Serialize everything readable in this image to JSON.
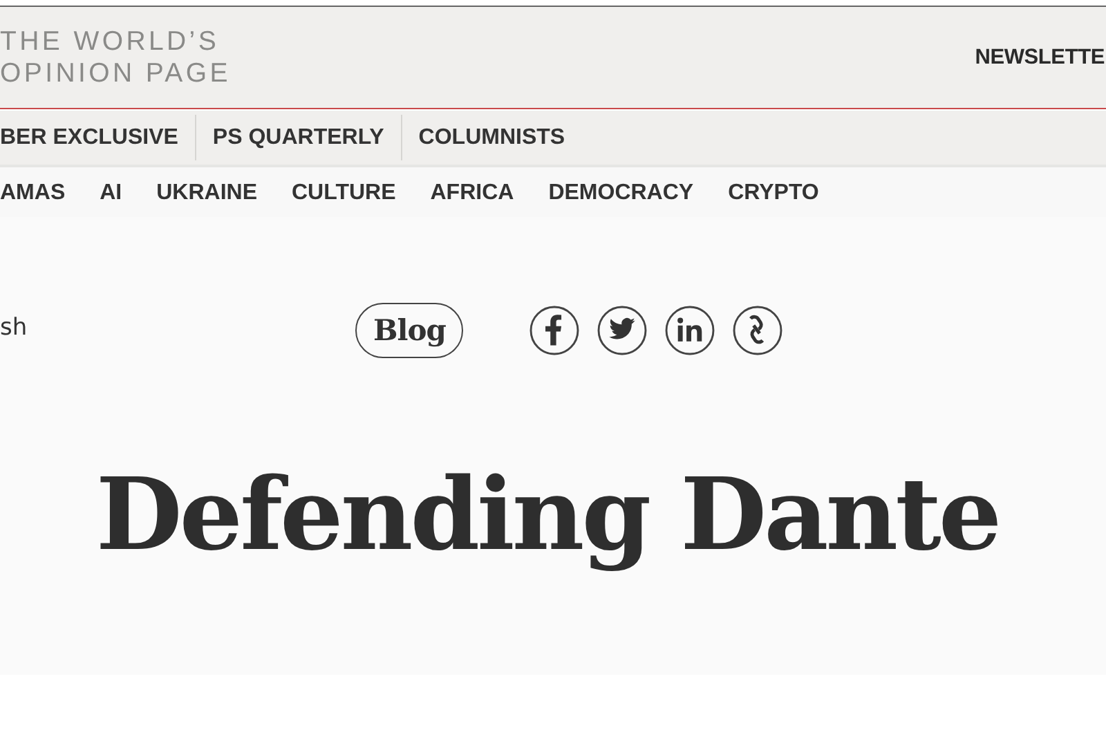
{
  "masthead": {
    "tagline_lines": [
      "THE WORLD’S",
      "OPINION PAGE"
    ],
    "newsletter_link": "NEWSLETTE"
  },
  "primary_nav": [
    {
      "label": "BER EXCLUSIVE"
    },
    {
      "label": "PS QUARTERLY"
    },
    {
      "label": "COLUMNISTS"
    }
  ],
  "topic_nav": [
    {
      "label": "AMAS"
    },
    {
      "label": "AI"
    },
    {
      "label": "UKRAINE"
    },
    {
      "label": "CULTURE"
    },
    {
      "label": "AFRICA"
    },
    {
      "label": "DEMOCRACY"
    },
    {
      "label": "CRYPTO"
    }
  ],
  "article": {
    "language_text": "sh",
    "section_badge": "Blog",
    "share_icons": [
      {
        "kind": "facebook"
      },
      {
        "kind": "twitter"
      },
      {
        "kind": "linkedin"
      },
      {
        "kind": "link"
      }
    ],
    "title": "Defending Dante"
  }
}
